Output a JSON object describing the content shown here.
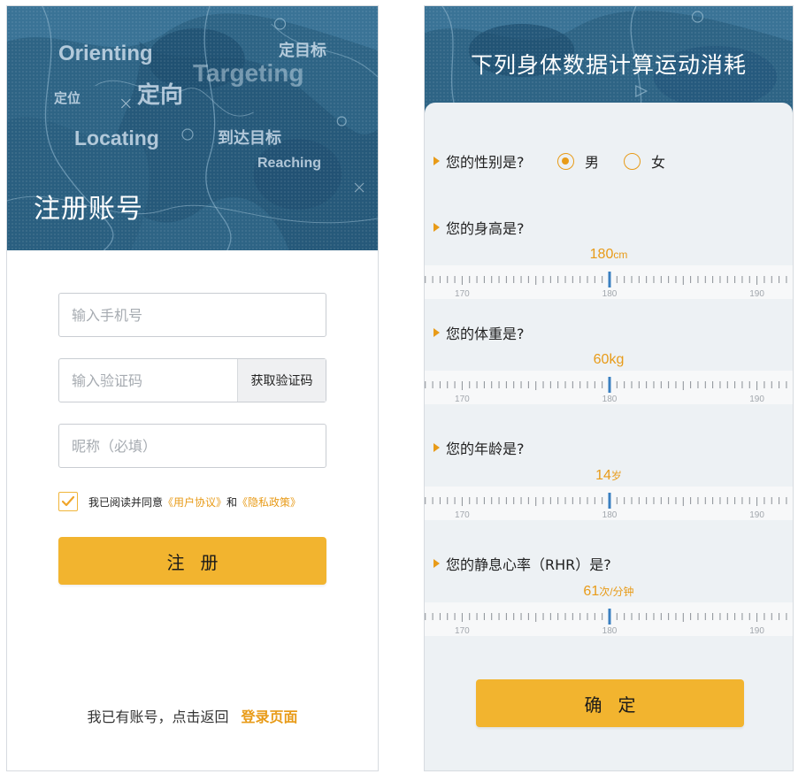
{
  "register": {
    "banner_words": {
      "orienting": "Orienting",
      "targeting": "Targeting",
      "locating": "Locating",
      "reaching": "Reaching",
      "dingwei": "定位",
      "dingxiang": "定向",
      "dingmubiao": "定目标",
      "daoda": "到达目标"
    },
    "title": "注册账号",
    "phone_placeholder": "输入手机号",
    "code_placeholder": "输入验证码",
    "get_code_label": "获取验证码",
    "nickname_placeholder": "昵称（必填）",
    "agree_checked": true,
    "agree_prefix": "我已阅读并同意",
    "user_agreement": "《用户协议》",
    "agree_and": "和",
    "privacy_policy": "《隐私政策》",
    "register_label": "注册",
    "has_account_text": "我已有账号，点击返回",
    "login_link": "登录页面"
  },
  "body_data": {
    "title": "下列身体数据计算运动消耗",
    "gender": {
      "question": "您的性别是?",
      "options": [
        "男",
        "女"
      ],
      "selected": "男"
    },
    "height": {
      "question": "您的身高是?",
      "value": "180",
      "unit": "cm",
      "ticks": [
        "170",
        "180",
        "190"
      ]
    },
    "weight": {
      "question": "您的体重是?",
      "value": "60",
      "unit": "kg",
      "ticks": [
        "170",
        "180",
        "190"
      ]
    },
    "age": {
      "question": "您的年龄是?",
      "value": "14",
      "unit": "岁",
      "ticks": [
        "170",
        "180",
        "190"
      ]
    },
    "rhr": {
      "question": "您的静息心率（RHR）是?",
      "value": "61",
      "unit": "次/分钟",
      "ticks": [
        "170",
        "180",
        "190"
      ]
    },
    "confirm_label": "确定"
  },
  "colors": {
    "accent": "#f2b42f",
    "accent_text": "#e89b18",
    "map_blue": "#2b5f7f",
    "ruler_pointer": "#3a7fc1"
  }
}
